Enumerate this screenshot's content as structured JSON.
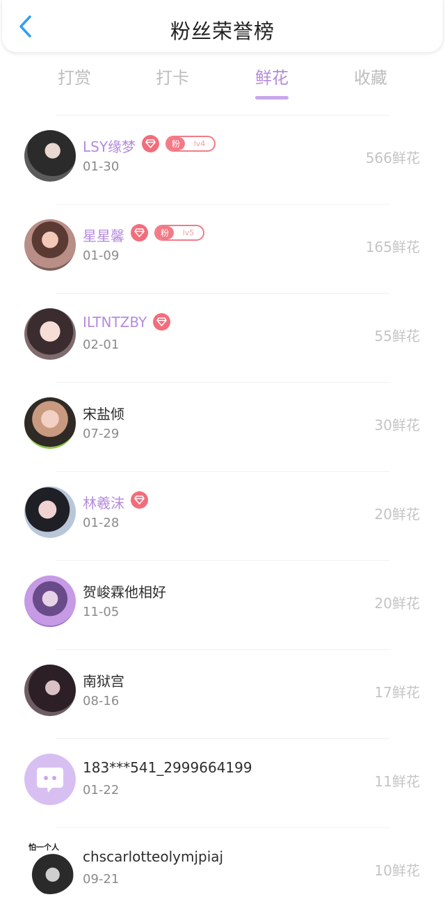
{
  "header": {
    "title": "粉丝荣誉榜"
  },
  "tabs": [
    {
      "label": "打赏",
      "active": false
    },
    {
      "label": "打卡",
      "active": false
    },
    {
      "label": "鲜花",
      "active": true
    },
    {
      "label": "收藏",
      "active": false
    }
  ],
  "fans": [
    {
      "name": "LSY缘梦",
      "date": "01-30",
      "count": "566鲜花",
      "vip": true,
      "fan_badge": {
        "tag": "粉",
        "level": "lv4"
      }
    },
    {
      "name": "星星馨",
      "date": "01-09",
      "count": "165鲜花",
      "vip": true,
      "fan_badge": {
        "tag": "粉",
        "level": "lv5"
      }
    },
    {
      "name": "ILTNTZBY",
      "date": "02-01",
      "count": "55鲜花",
      "vip": true
    },
    {
      "name": "宋盐倾",
      "date": "07-29",
      "count": "30鲜花",
      "vip": false
    },
    {
      "name": "林羲沫",
      "date": "01-28",
      "count": "20鲜花",
      "vip": true
    },
    {
      "name": "贺峻霖他相好",
      "date": "11-05",
      "count": "20鲜花",
      "vip": false
    },
    {
      "name": "南狱宫",
      "date": "08-16",
      "count": "17鲜花",
      "vip": false
    },
    {
      "name": "183***541_2999664199",
      "date": "01-22",
      "count": "11鲜花",
      "vip": false,
      "default_avatar": true
    },
    {
      "name": "chscarlotteolymjpiaj",
      "date": "09-21",
      "count": "10鲜花",
      "vip": false,
      "avatar_caption": "怕一个人"
    }
  ],
  "colors": {
    "accent": "#b48bdc",
    "badge_red": "#f26d7b",
    "count_gray": "#c4c4c4",
    "back_arrow": "#2f9ef2"
  }
}
